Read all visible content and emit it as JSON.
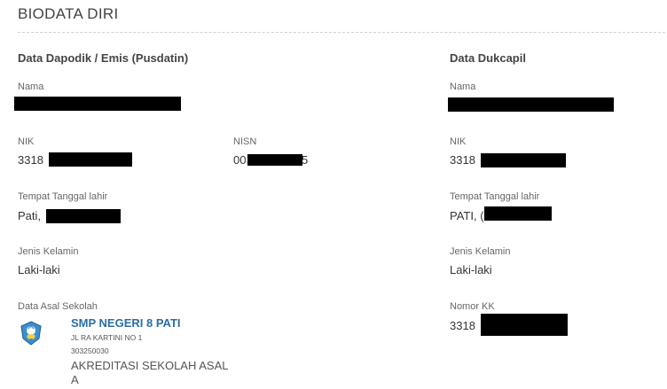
{
  "page": {
    "title": "BIODATA DIRI"
  },
  "left": {
    "section_title": "Data Dapodik / Emis (Pusdatin)",
    "nama_label": "Nama",
    "nik_label": "NIK",
    "nik_visible": "3318",
    "nisn_label": "NISN",
    "nisn_visible": "00",
    "nisn_tail": "5",
    "ttl_label": "Tempat Tanggal lahir",
    "ttl_visible": "Pati,",
    "jk_label": "Jenis Kelamin",
    "jk_value": "Laki-laki",
    "asal_label": "Data Asal Sekolah"
  },
  "school": {
    "name": "SMP NEGERI 8 PATI",
    "address": "JL RA KARTINI NO 1",
    "npsn": "303250030",
    "akreditasi_label": "AKREDITASI SEKOLAH ASAL",
    "akreditasi_value": "A",
    "logo_icon": "tut-wuri-handayani-logo-icon"
  },
  "right": {
    "section_title": "Data Dukcapil",
    "nama_label": "Nama",
    "nik_label": "NIK",
    "nik_visible": "3318",
    "ttl_label": "Tempat Tanggal lahir",
    "ttl_visible": "PATI, (",
    "jk_label": "Jenis Kelamin",
    "jk_value": "Laki-laki",
    "kk_label": "Nomor KK",
    "kk_visible": "3318"
  }
}
